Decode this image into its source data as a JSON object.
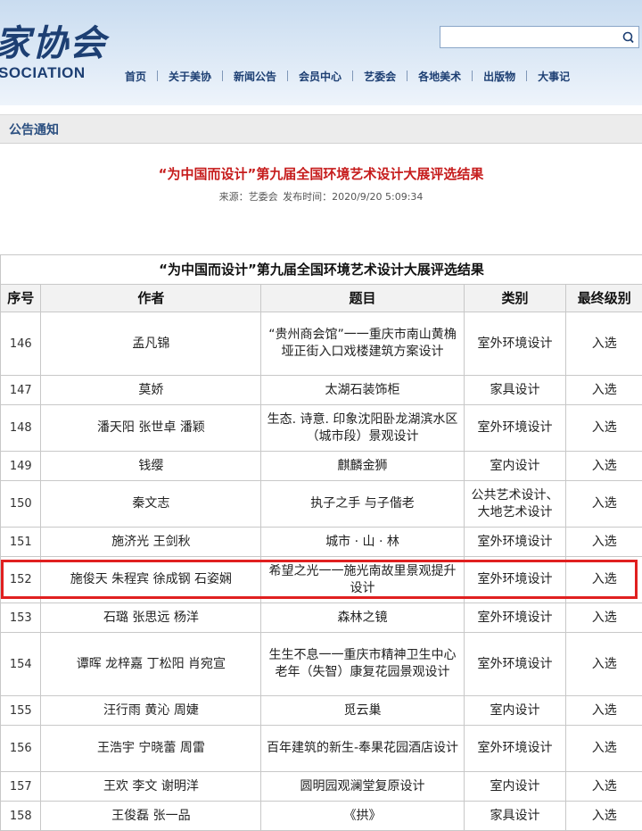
{
  "header": {
    "logo_cn": "家协会",
    "logo_en": "SOCIATION",
    "search": {
      "value": "",
      "placeholder": "",
      "icon": "search-icon"
    },
    "nav": [
      "首页",
      "关于美协",
      "新闻公告",
      "会员中心",
      "艺委会",
      "各地美术",
      "出版物",
      "大事记"
    ]
  },
  "section": {
    "title": "公告通知"
  },
  "article": {
    "title": "“为中国而设计”第九届全国环境艺术设计大展评选结果",
    "source_label": "来源：",
    "source": "艺委会",
    "time_label": "发布时间：",
    "time": "2020/9/20 5:09:34"
  },
  "table": {
    "caption": "“为中国而设计”第九届全国环境艺术设计大展评选结果",
    "columns": [
      "序号",
      "作者",
      "题目",
      "类别",
      "最终级别"
    ],
    "rows": [
      {
        "no": "146",
        "author": "孟凡锦",
        "title": "“贵州商会馆”一一重庆市南山黄桷垭正街入口戏楼建筑方案设计",
        "type": "室外环境设计",
        "level": "入选"
      },
      {
        "no": "147",
        "author": "莫娇",
        "title": "太湖石装饰柜",
        "type": "家具设计",
        "level": "入选"
      },
      {
        "no": "148",
        "author": "潘天阳 张世卓 潘颖",
        "title": "生态. 诗意. 印象沈阳卧龙湖滨水区（城市段）景观设计",
        "type": "室外环境设计",
        "level": "入选"
      },
      {
        "no": "149",
        "author": "钱缨",
        "title": "麒麟金狮",
        "type": "室内设计",
        "level": "入选"
      },
      {
        "no": "150",
        "author": "秦文志",
        "title": "执子之手 与子偕老",
        "type": "公共艺术设计、大地艺术设计",
        "level": "入选"
      },
      {
        "no": "151",
        "author": "施济光 王剑秋",
        "title": "城市 · 山 · 林",
        "type": "室外环境设计",
        "level": "入选"
      },
      {
        "no": "152",
        "author": "施俊天 朱程宾 徐成钢 石姿娴",
        "title": "希望之光一一施光南故里景观提升设计",
        "type": "室外环境设计",
        "level": "入选"
      },
      {
        "no": "153",
        "author": "石璐 张思远 杨洋",
        "title": "森林之镜",
        "type": "室外环境设计",
        "level": "入选"
      },
      {
        "no": "154",
        "author": "谭晖 龙梓嘉 丁松阳 肖宛宣",
        "title": "生生不息一一重庆市精神卫生中心老年（失智）康复花园景观设计",
        "type": "室外环境设计",
        "level": "入选"
      },
      {
        "no": "155",
        "author": "汪行雨 黄沁 周婕",
        "title": "觅云巢",
        "type": "室内设计",
        "level": "入选"
      },
      {
        "no": "156",
        "author": "王浩宇 宁晓蕾 周雷",
        "title": "百年建筑的新生-奉果花园酒店设计",
        "type": "室外环境设计",
        "level": "入选"
      },
      {
        "no": "157",
        "author": "王欢 李文 谢明洋",
        "title": "圆明园观澜堂复原设计",
        "type": "室内设计",
        "level": "入选"
      },
      {
        "no": "158",
        "author": "王俊磊 张一品",
        "title": "《拱》",
        "type": "家具设计",
        "level": "入选"
      }
    ]
  },
  "colors": {
    "title_red": "#c61c1c",
    "nav_blue": "#1d3f73",
    "highlight": "#e02020"
  }
}
